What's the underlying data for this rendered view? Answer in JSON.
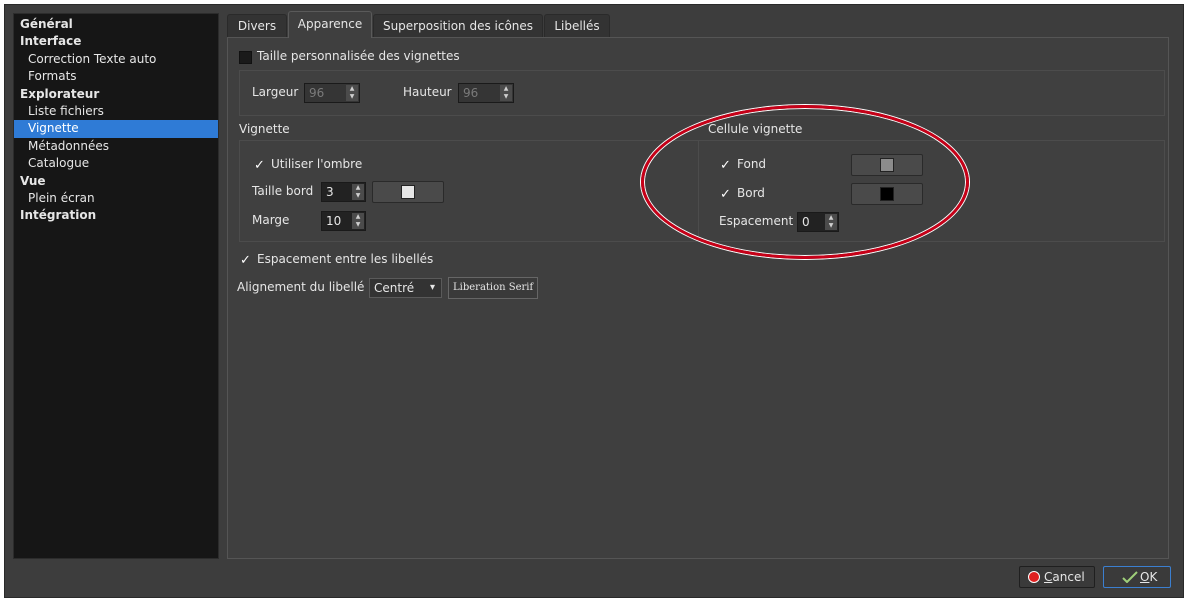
{
  "sidebar": {
    "items": [
      {
        "label": "Général",
        "kind": "cat"
      },
      {
        "label": "Interface",
        "kind": "cat"
      },
      {
        "label": "Correction Texte auto",
        "kind": "sub"
      },
      {
        "label": "Formats",
        "kind": "sub"
      },
      {
        "label": "Explorateur",
        "kind": "cat"
      },
      {
        "label": "Liste fichiers",
        "kind": "sub"
      },
      {
        "label": "Vignette",
        "kind": "sub",
        "selected": true
      },
      {
        "label": "Métadonnées",
        "kind": "sub"
      },
      {
        "label": "Catalogue",
        "kind": "sub"
      },
      {
        "label": "Vue",
        "kind": "cat"
      },
      {
        "label": "Plein écran",
        "kind": "sub"
      },
      {
        "label": "Intégration",
        "kind": "cat"
      }
    ]
  },
  "tabs": [
    {
      "label": "Divers",
      "active": false
    },
    {
      "label": "Apparence",
      "active": true
    },
    {
      "label": "Superposition des icônes",
      "active": false
    },
    {
      "label": "Libellés",
      "active": false
    }
  ],
  "thumbnail_size": {
    "custom_label": "Taille personnalisée des vignettes",
    "custom_checked": false,
    "width_label": "Largeur",
    "width_value": "96",
    "height_label": "Hauteur",
    "height_value": "96"
  },
  "vignette": {
    "title": "Vignette",
    "shadow_label": "Utiliser l'ombre",
    "shadow_checked": true,
    "border_size_label": "Taille bord",
    "border_size_value": "3",
    "border_color": "#e6e6e6",
    "margin_label": "Marge",
    "margin_value": "10"
  },
  "cell": {
    "title": "Cellule vignette",
    "background_label": "Fond",
    "background_checked": true,
    "background_color": "#8c8c8c",
    "border_label": "Bord",
    "border_checked": true,
    "border_color": "#000000",
    "spacing_label": "Espacement",
    "spacing_value": "0"
  },
  "labels": {
    "spacing_label": "Espacement entre les libellés",
    "spacing_checked": true,
    "alignment_label": "Alignement du libellé",
    "alignment_value": "Centré",
    "font_button": "Liberation Serif"
  },
  "icons": {
    "check": "✓",
    "spin_up": "▲",
    "spin_down": "▼",
    "dropdown": "▾",
    "cancel": "red-circle",
    "ok": "checkmark-arrow"
  },
  "buttons": {
    "cancel_first": "C",
    "cancel_rest": "ancel",
    "ok_first": "O",
    "ok_rest": "K"
  },
  "colors": {
    "accent": "#2f7bd6",
    "annotation": "#c70018"
  }
}
